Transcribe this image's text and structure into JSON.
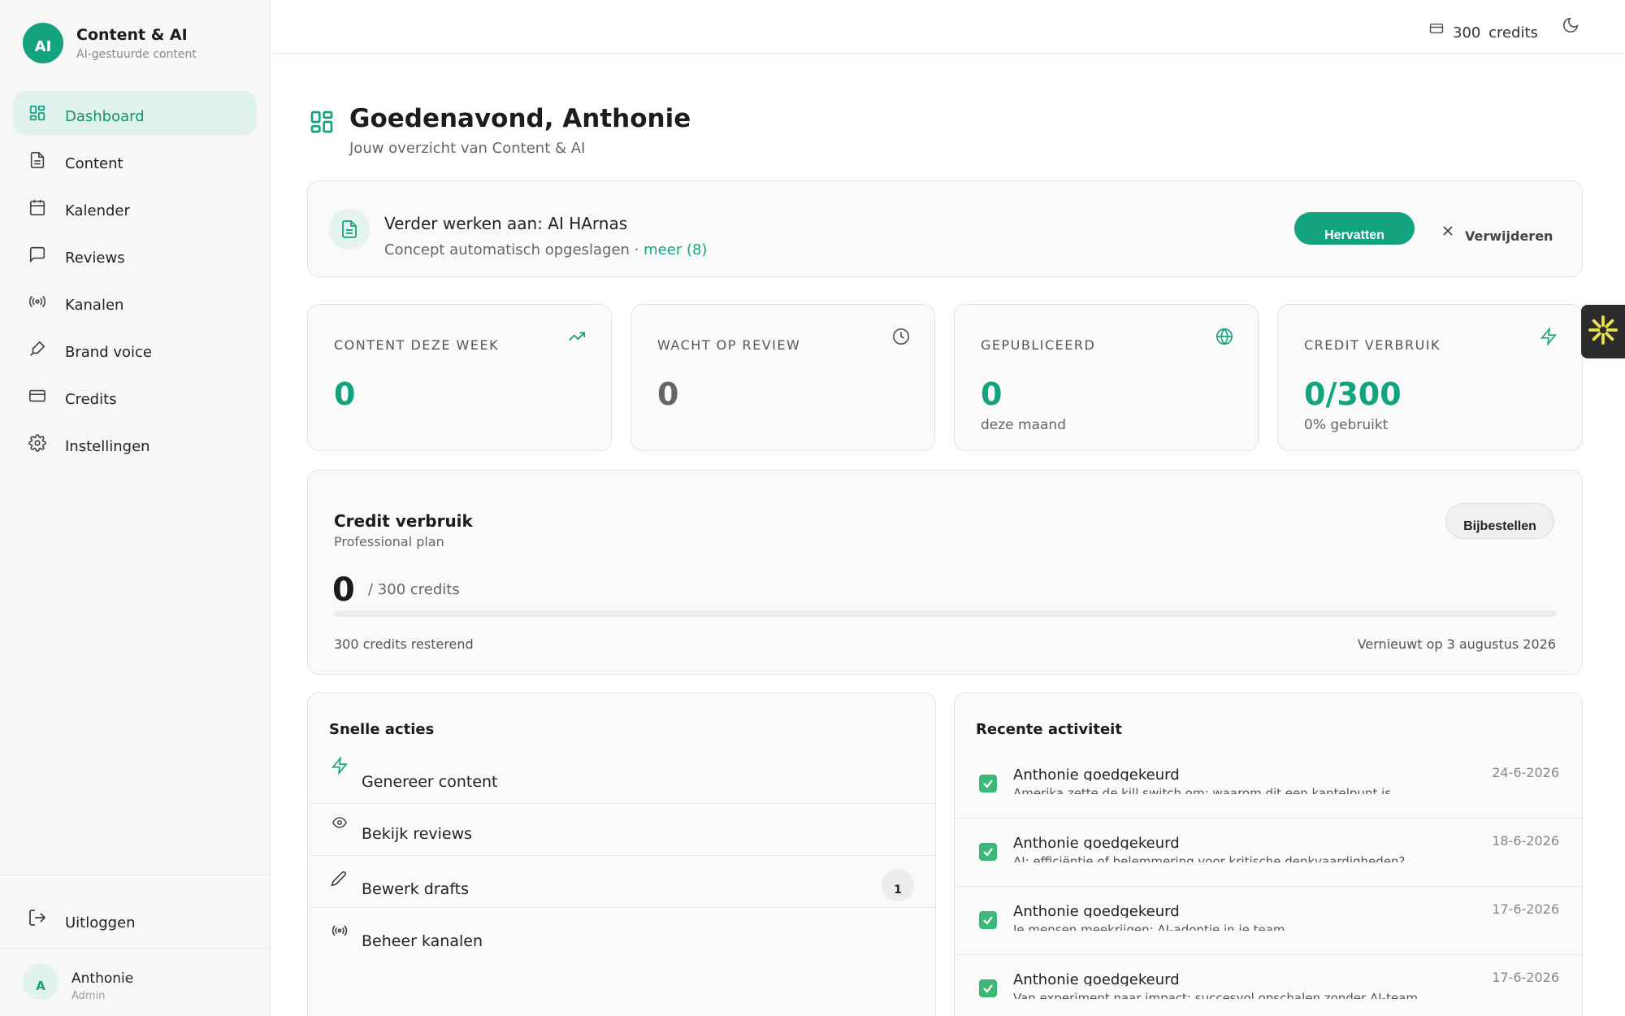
{
  "brand": {
    "logo": "AI",
    "title": "Content & AI",
    "subtitle": "AI-gestuurde content"
  },
  "sidebar": {
    "items": [
      {
        "label": "Dashboard",
        "icon": "grid-icon",
        "active": true
      },
      {
        "label": "Content",
        "icon": "document-icon"
      },
      {
        "label": "Kalender",
        "icon": "calendar-icon"
      },
      {
        "label": "Reviews",
        "icon": "chat-icon"
      },
      {
        "label": "Kanalen",
        "icon": "broadcast-icon"
      },
      {
        "label": "Brand voice",
        "icon": "pen-icon"
      },
      {
        "label": "Credits",
        "icon": "credit-card-icon"
      },
      {
        "label": "Instellingen",
        "icon": "gear-icon"
      }
    ],
    "logout_label": "Uitloggen",
    "user": {
      "initial": "A",
      "name": "Anthonie",
      "role": "Admin"
    }
  },
  "topbar": {
    "credits": "300 credits",
    "theme_icon": "moon-icon"
  },
  "header": {
    "title": "Goedenavond, Anthonie",
    "subtitle": "Jouw overzicht van Content & AI"
  },
  "resume": {
    "title": "Verder werken aan: AI HArnas",
    "subtitle": "Concept automatisch opgeslagen ·",
    "more_link": "meer (8)",
    "resume_label": "Hervatten",
    "remove_label": "Verwijderen"
  },
  "stats": [
    {
      "label": "CONTENT DEZE WEEK",
      "value": "0",
      "sub": "",
      "icon": "trending-up-icon"
    },
    {
      "label": "WACHT OP REVIEW",
      "value": "0",
      "sub": "",
      "icon": "clock-icon"
    },
    {
      "label": "GEPUBLICEERD",
      "value": "0",
      "sub": "deze maand",
      "icon": "globe-icon"
    },
    {
      "label": "CREDIT VERBRUIK",
      "value": "0/300",
      "sub": "0% gebruikt",
      "icon": "lightning-icon"
    }
  ],
  "credit_usage": {
    "title": "Credit verbruik",
    "plan": "Professional plan",
    "order_label": "Bijbestellen",
    "used": "0",
    "of_total": "/ 300 credits",
    "progress_fraction": 0,
    "remaining": "300 credits resterend",
    "renewal": "Vernieuwt op 3 augustus 2026"
  },
  "quick_actions": {
    "title": "Snelle acties",
    "items": [
      {
        "label": "Genereer content",
        "icon": "lightning-icon"
      },
      {
        "label": "Bekijk reviews",
        "icon": "eye-icon"
      },
      {
        "label": "Bewerk drafts",
        "icon": "pencil-icon",
        "badge": "1"
      },
      {
        "label": "Beheer kanalen",
        "icon": "broadcast-icon"
      }
    ]
  },
  "recent_activity": {
    "title": "Recente activiteit",
    "items": [
      {
        "title": "Anthonie goedgekeurd",
        "desc": "Amerika zette de kill switch om: waarom dit een kantelpunt is",
        "date": "24-6-2026"
      },
      {
        "title": "Anthonie goedgekeurd",
        "desc": "AI: efficiëntie of belemmering voor kritische denkvaardigheden?",
        "date": "18-6-2026"
      },
      {
        "title": "Anthonie goedgekeurd",
        "desc": "Je mensen meekrijgen: AI-adoptie in je team",
        "date": "17-6-2026"
      },
      {
        "title": "Anthonie goedgekeurd",
        "desc": "Van experiment naar impact: succesvol opschalen zonder AI-team",
        "date": "17-6-2026"
      }
    ]
  },
  "colors": {
    "accent": "#14a37f",
    "accent_soft": "#dff2ec",
    "check": "#3cb878"
  }
}
